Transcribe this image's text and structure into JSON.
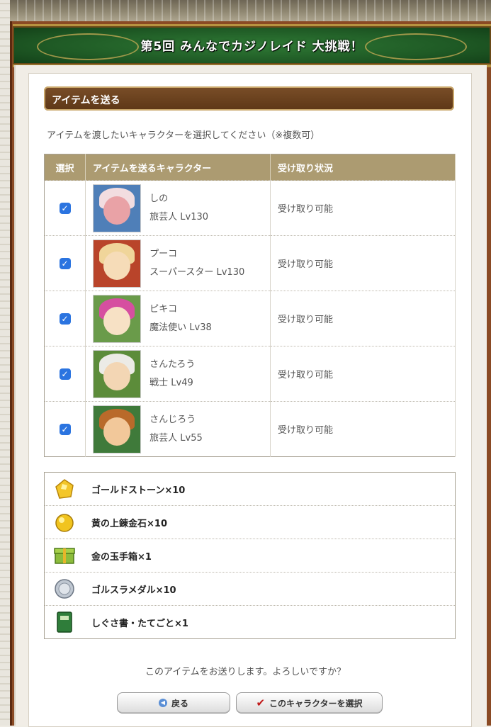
{
  "banner": {
    "title": "第5回 みんなでカジノレイド 大挑戦！"
  },
  "section": {
    "title": "アイテムを送る"
  },
  "instruction": "アイテムを渡したいキャラクターを選択してください（※複数可）",
  "table": {
    "headers": [
      "選択",
      "アイテムを送るキャラクター",
      "受け取り状況"
    ],
    "rows": [
      {
        "checked": true,
        "name": "しの",
        "job": "旅芸人 Lv130",
        "status": "受け取り可能"
      },
      {
        "checked": true,
        "name": "プーコ",
        "job": "スーパースター Lv130",
        "status": "受け取り可能"
      },
      {
        "checked": true,
        "name": "ピキコ",
        "job": "魔法使い Lv38",
        "status": "受け取り可能"
      },
      {
        "checked": true,
        "name": "さんたろう",
        "job": "戦士 Lv49",
        "status": "受け取り可能"
      },
      {
        "checked": true,
        "name": "さんじろう",
        "job": "旅芸人 Lv55",
        "status": "受け取り可能"
      }
    ]
  },
  "items": [
    {
      "label": "ゴールドストーン×10",
      "icon": "gold-stone-icon"
    },
    {
      "label": "黄の上錬金石×10",
      "icon": "yellow-alchemy-stone-icon"
    },
    {
      "label": "金の玉手箱×1",
      "icon": "gold-treasure-box-icon"
    },
    {
      "label": "ゴルスラメダル×10",
      "icon": "gold-slime-medal-icon"
    },
    {
      "label": "しぐさ書・たてごと×1",
      "icon": "gesture-book-icon"
    }
  ],
  "confirm_text": "このアイテムをお送りします。よろしいですか？",
  "buttons": {
    "back": "戻る",
    "select": "このキャラクターを選択"
  }
}
